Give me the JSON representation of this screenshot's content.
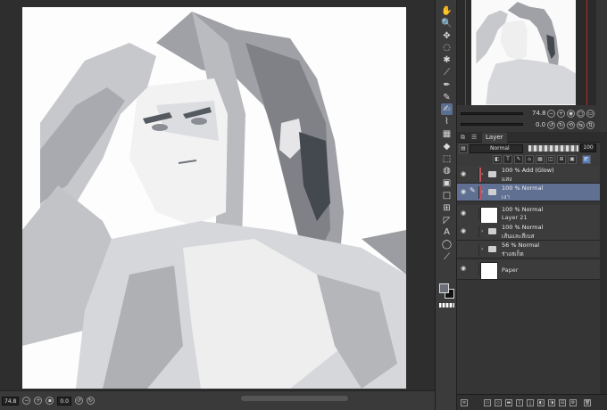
{
  "status_bar": {
    "zoom": "74.8",
    "rotation": "0.0"
  },
  "tools": [
    {
      "icon": "hand-icon",
      "glyph": "✋"
    },
    {
      "icon": "zoom-icon",
      "glyph": "🔍"
    },
    {
      "icon": "move-icon",
      "glyph": "✥"
    },
    {
      "icon": "lasso-icon",
      "glyph": "◌"
    },
    {
      "icon": "magic-wand-icon",
      "glyph": "✱"
    },
    {
      "icon": "eyedropper-icon",
      "glyph": "⟋"
    },
    {
      "icon": "pen-icon",
      "glyph": "✒"
    },
    {
      "icon": "pencil-icon",
      "glyph": "✎"
    },
    {
      "icon": "brush-icon",
      "glyph": "✍"
    },
    {
      "icon": "airbrush-icon",
      "glyph": "⌇"
    },
    {
      "icon": "decoration-icon",
      "glyph": "▦"
    },
    {
      "icon": "eraser-icon",
      "glyph": "◆"
    },
    {
      "icon": "blend-icon",
      "glyph": "⬚"
    },
    {
      "icon": "fill-icon",
      "glyph": "◍"
    },
    {
      "icon": "gradient-icon",
      "glyph": "▣"
    },
    {
      "icon": "figure-icon",
      "glyph": "□"
    },
    {
      "icon": "frame-icon",
      "glyph": "⊞"
    },
    {
      "icon": "ruler-icon",
      "glyph": "◸"
    },
    {
      "icon": "text-icon",
      "glyph": "A"
    },
    {
      "icon": "balloon-icon",
      "glyph": "◯"
    },
    {
      "icon": "line-correction-icon",
      "glyph": "⟋"
    }
  ],
  "colors": {
    "main": "#6b6e78",
    "sub": "#111111",
    "selected_layer": "#5f7093",
    "layer_color_tab": "#c6505a"
  },
  "navigator": {
    "zoom": "74.8",
    "rotation": "0.0"
  },
  "layer_panel": {
    "tab_label": "Layer",
    "blend_mode": "Normal",
    "opacity": "100",
    "layers": [
      {
        "line1": "100 %  Add (Glow)",
        "line2": "แสง",
        "type": "folder",
        "selected": false,
        "color_tab": true
      },
      {
        "line1": "100 %  Normal",
        "line2": "เงา",
        "type": "folder",
        "selected": true,
        "color_tab": true
      },
      {
        "line1": "100 %  Normal",
        "line2": "Layer 21",
        "type": "raster",
        "selected": false,
        "color_tab": false
      },
      {
        "line1": "100 %  Normal",
        "line2": "เส้นและสีเบส",
        "type": "folder",
        "selected": false,
        "color_tab": false
      },
      {
        "line1": "56 %  Normal",
        "line2": "ร่างสเก็ต",
        "type": "folder",
        "selected": false,
        "color_tab": false
      },
      {
        "line1": "",
        "line2": "Paper",
        "type": "paper",
        "selected": false,
        "color_tab": false
      }
    ]
  }
}
